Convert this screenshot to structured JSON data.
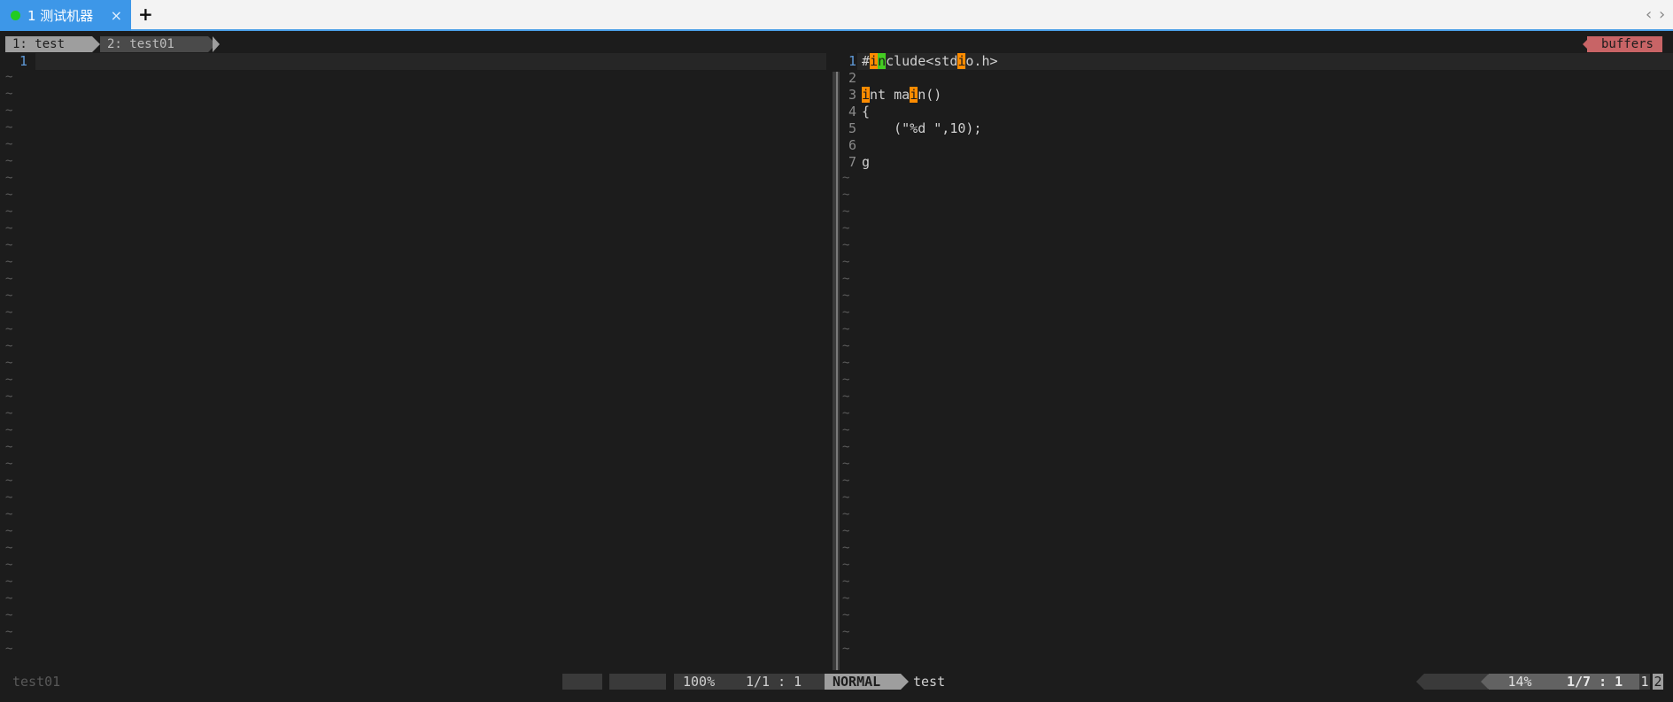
{
  "tabbar": {
    "tab_label": "1 测试机器",
    "close_glyph": "×",
    "add_glyph": "+",
    "prev_glyph": "‹",
    "next_glyph": "›"
  },
  "bufline": {
    "tab1": "1: test",
    "tab2": "2: test01",
    "buffers_label": "buffers"
  },
  "left_pane": {
    "line_number": "1"
  },
  "right_pane": {
    "lines": [
      {
        "num": "1",
        "segments": [
          [
            "#",
            ""
          ],
          [
            "i",
            "o"
          ],
          [
            "n",
            "g"
          ],
          [
            "clude<std",
            ""
          ],
          [
            "i",
            "o"
          ],
          [
            "o.h>",
            ""
          ]
        ]
      },
      {
        "num": "2",
        "segments": []
      },
      {
        "num": "3",
        "segments": [
          [
            "i",
            "o"
          ],
          [
            "nt ma",
            ""
          ],
          [
            "i",
            "o"
          ],
          [
            "n()",
            ""
          ]
        ]
      },
      {
        "num": "4",
        "segments": [
          [
            "{",
            ""
          ]
        ]
      },
      {
        "num": "5",
        "segments": [
          [
            "    (\"%d \",10);",
            ""
          ]
        ]
      },
      {
        "num": "6",
        "segments": []
      },
      {
        "num": "7",
        "segments": [
          [
            "g",
            ""
          ]
        ]
      }
    ]
  },
  "status": {
    "left_filename": "test01",
    "left_percent": "100%",
    "left_position": "1/1 :  1",
    "mode": "NORMAL",
    "right_filename": "test",
    "right_percent": "14%",
    "right_position": "1/7 :  1",
    "win1": "1",
    "win2": "2"
  },
  "colors": {
    "bg": "#1c1c1c",
    "accent_tab": "#3d97e8",
    "buffers": "#c86466",
    "highlight_orange": "#ff8c00",
    "highlight_green": "#44cc22"
  },
  "tilde": "~"
}
